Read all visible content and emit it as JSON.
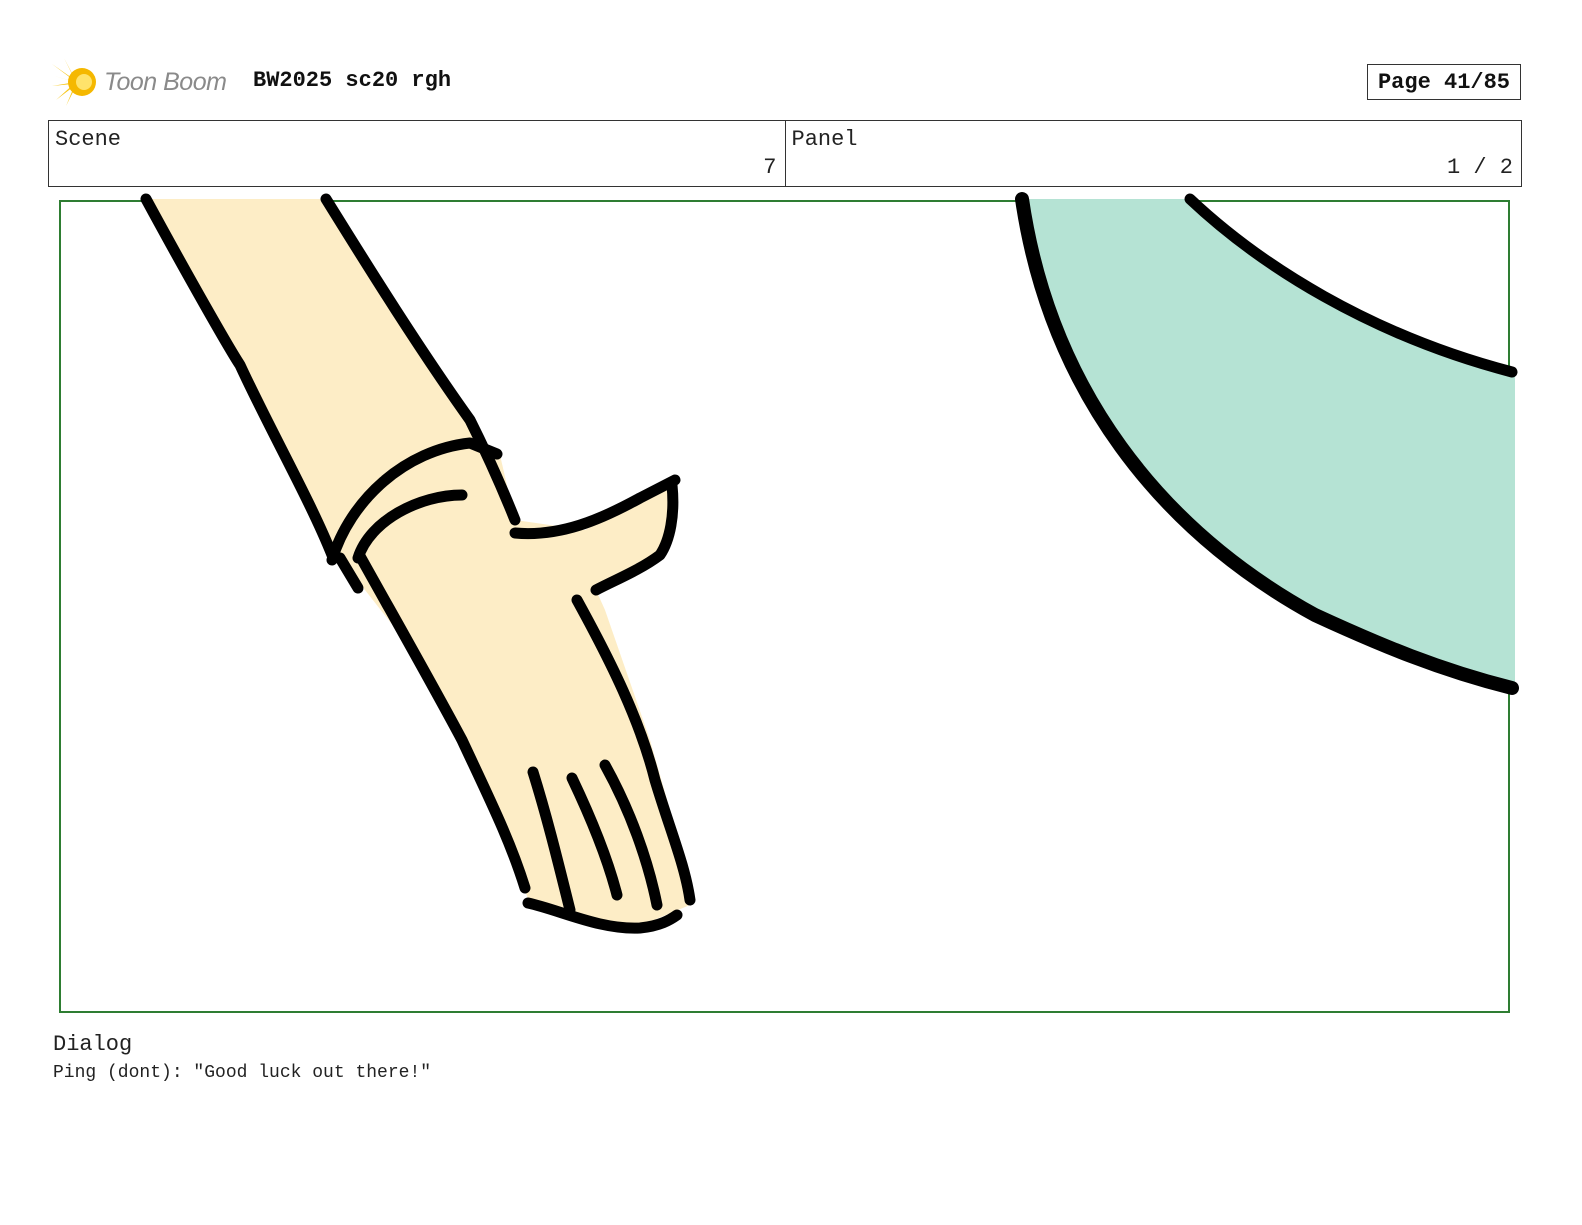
{
  "header": {
    "logo_text": "Toon Boom",
    "doc_title": "BW2025 sc20 rgh",
    "page_indicator": "Page 41/85"
  },
  "info": {
    "scene_label": "Scene",
    "scene_value": "7",
    "panel_label": "Panel",
    "panel_value": "1 / 2"
  },
  "dialog": {
    "label": "Dialog",
    "text": "Ping (dont): \"Good luck out there!\""
  },
  "colors": {
    "frame": "#2e7d32",
    "skin": "#fdedc6",
    "teal": "#b5e3d4",
    "logo_star": "#f7c512"
  }
}
